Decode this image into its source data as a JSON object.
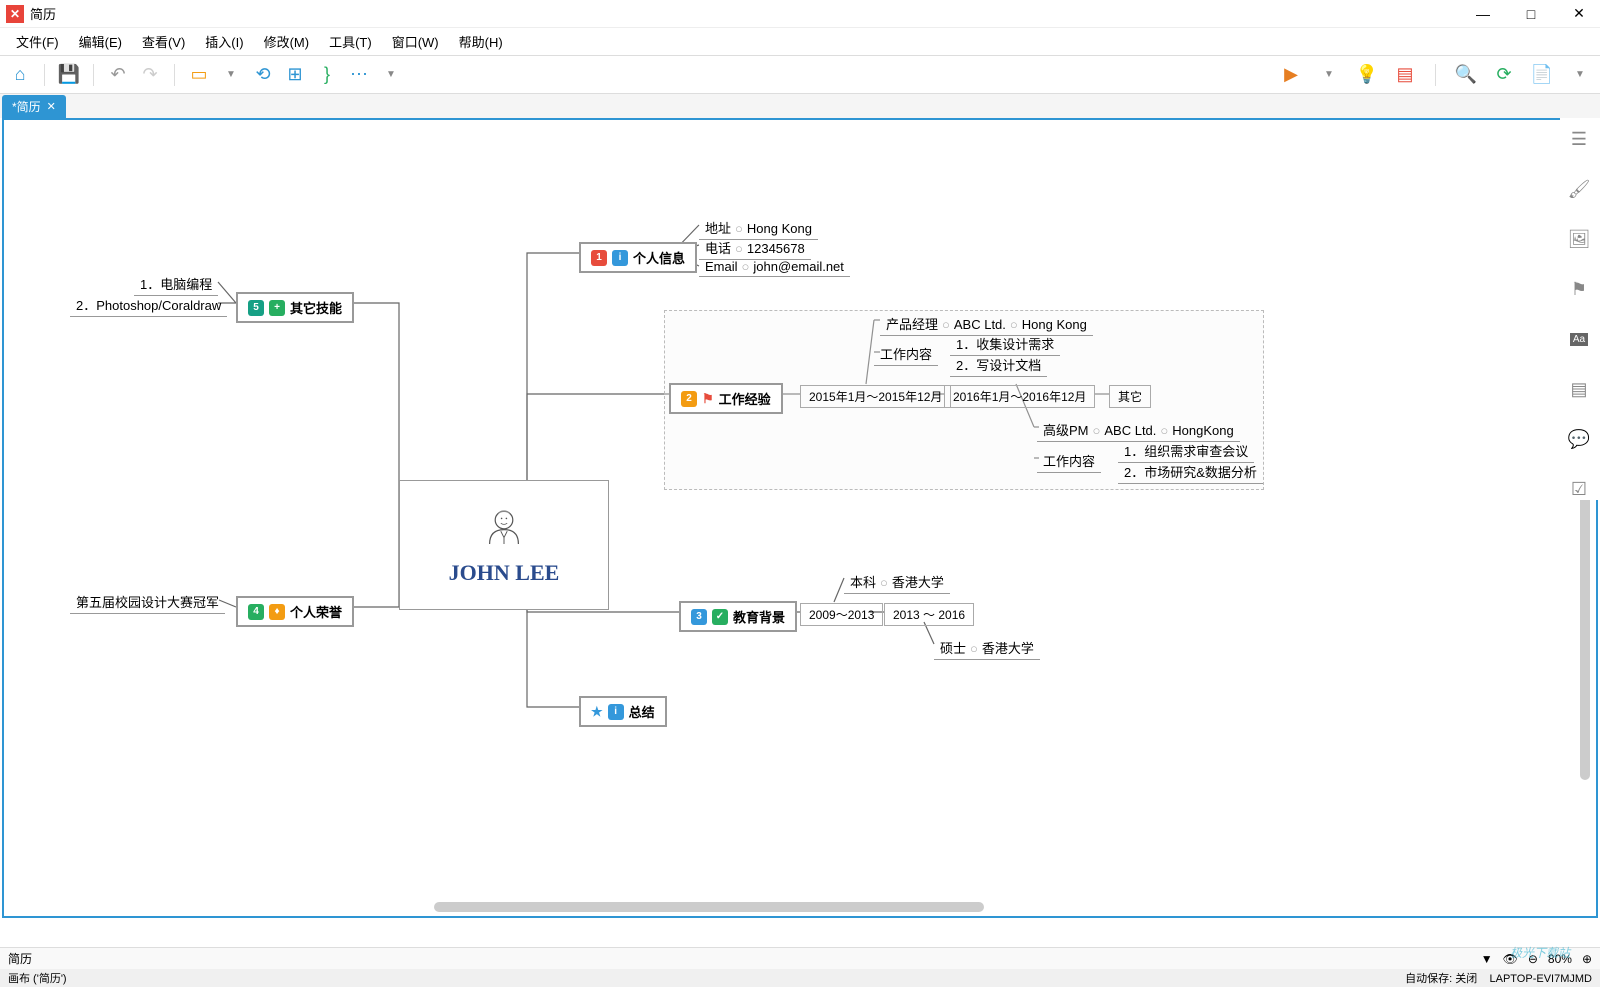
{
  "window": {
    "title": "简历"
  },
  "menu": {
    "file": "文件(F)",
    "edit": "编辑(E)",
    "view": "查看(V)",
    "insert": "插入(I)",
    "modify": "修改(M)",
    "tool": "工具(T)",
    "window": "窗口(W)",
    "help": "帮助(H)"
  },
  "tab": {
    "name": "*简历"
  },
  "central": {
    "name": "JOHN LEE"
  },
  "nodes": {
    "personal": "个人信息",
    "work": "工作经验",
    "edu": "教育背景",
    "summary": "总结",
    "skills": "其它技能",
    "honor": "个人荣誉"
  },
  "personal": {
    "addr_label": "地址",
    "addr_val": "Hong Kong",
    "tel_label": "电话",
    "tel_val": "12345678",
    "email_label": "Email",
    "email_val": "john@email.net"
  },
  "work": {
    "period1": "2015年1月～2015年12月",
    "period2": "2016年1月～2016年12月",
    "other": "其它",
    "job1_title": "产品经理",
    "job1_company": "ABC Ltd.",
    "job1_loc": "Hong Kong",
    "job1_content_label": "工作内容",
    "job1_task1": "1．收集设计需求",
    "job1_task2": "2．写设计文档",
    "job2_title": "高级PM",
    "job2_company": "ABC Ltd.",
    "job2_loc": "HongKong",
    "job2_content_label": "工作内容",
    "job2_task1": "1．组织需求审查会议",
    "job2_task2": "2．市场研究&数据分析"
  },
  "edu": {
    "period1": "2009～2013",
    "period2": "2013 ～ 2016",
    "degree1": "本科",
    "school1": "香港大学",
    "degree2": "硕士",
    "school2": "香港大学"
  },
  "skills": {
    "s1": "1．电脑编程",
    "s2": "2．Photoshop/Coraldraw"
  },
  "honor": {
    "h1": "第五届校园设计大赛冠军"
  },
  "bottom": {
    "label": "简历",
    "zoom": "80%"
  },
  "status": {
    "canvas": "画布 ('简历')",
    "autosave": "自动保存: 关闭",
    "device": "LAPTOP-EVI7MJMD"
  },
  "watermark": "极光下载站"
}
